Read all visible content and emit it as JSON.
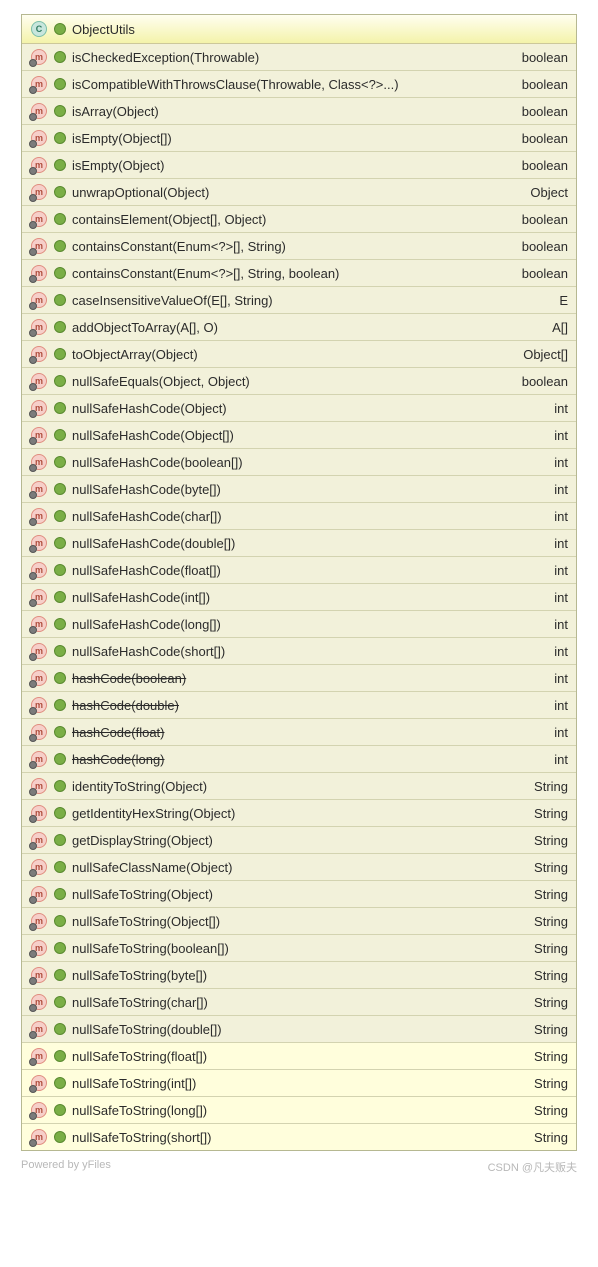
{
  "header": {
    "className": "ObjectUtils"
  },
  "rows": [
    {
      "name": "isCheckedException(Throwable)",
      "ret": "boolean",
      "deprecated": false,
      "highlight": false
    },
    {
      "name": "isCompatibleWithThrowsClause(Throwable, Class<?>...)",
      "ret": "boolean",
      "deprecated": false,
      "highlight": false
    },
    {
      "name": "isArray(Object)",
      "ret": "boolean",
      "deprecated": false,
      "highlight": false
    },
    {
      "name": "isEmpty(Object[])",
      "ret": "boolean",
      "deprecated": false,
      "highlight": false
    },
    {
      "name": "isEmpty(Object)",
      "ret": "boolean",
      "deprecated": false,
      "highlight": false
    },
    {
      "name": "unwrapOptional(Object)",
      "ret": "Object",
      "deprecated": false,
      "highlight": false
    },
    {
      "name": "containsElement(Object[], Object)",
      "ret": "boolean",
      "deprecated": false,
      "highlight": false
    },
    {
      "name": "containsConstant(Enum<?>[], String)",
      "ret": "boolean",
      "deprecated": false,
      "highlight": false
    },
    {
      "name": "containsConstant(Enum<?>[], String, boolean)",
      "ret": "boolean",
      "deprecated": false,
      "highlight": false
    },
    {
      "name": "caseInsensitiveValueOf(E[], String)",
      "ret": "E",
      "deprecated": false,
      "highlight": false
    },
    {
      "name": "addObjectToArray(A[], O)",
      "ret": "A[]",
      "deprecated": false,
      "highlight": false
    },
    {
      "name": "toObjectArray(Object)",
      "ret": "Object[]",
      "deprecated": false,
      "highlight": false
    },
    {
      "name": "nullSafeEquals(Object, Object)",
      "ret": "boolean",
      "deprecated": false,
      "highlight": false
    },
    {
      "name": "nullSafeHashCode(Object)",
      "ret": "int",
      "deprecated": false,
      "highlight": false
    },
    {
      "name": "nullSafeHashCode(Object[])",
      "ret": "int",
      "deprecated": false,
      "highlight": false
    },
    {
      "name": "nullSafeHashCode(boolean[])",
      "ret": "int",
      "deprecated": false,
      "highlight": false
    },
    {
      "name": "nullSafeHashCode(byte[])",
      "ret": "int",
      "deprecated": false,
      "highlight": false
    },
    {
      "name": "nullSafeHashCode(char[])",
      "ret": "int",
      "deprecated": false,
      "highlight": false
    },
    {
      "name": "nullSafeHashCode(double[])",
      "ret": "int",
      "deprecated": false,
      "highlight": false
    },
    {
      "name": "nullSafeHashCode(float[])",
      "ret": "int",
      "deprecated": false,
      "highlight": false
    },
    {
      "name": "nullSafeHashCode(int[])",
      "ret": "int",
      "deprecated": false,
      "highlight": false
    },
    {
      "name": "nullSafeHashCode(long[])",
      "ret": "int",
      "deprecated": false,
      "highlight": false
    },
    {
      "name": "nullSafeHashCode(short[])",
      "ret": "int",
      "deprecated": false,
      "highlight": false
    },
    {
      "name": "hashCode(boolean)",
      "ret": "int",
      "deprecated": true,
      "highlight": false
    },
    {
      "name": "hashCode(double)",
      "ret": "int",
      "deprecated": true,
      "highlight": false
    },
    {
      "name": "hashCode(float)",
      "ret": "int",
      "deprecated": true,
      "highlight": false
    },
    {
      "name": "hashCode(long)",
      "ret": "int",
      "deprecated": true,
      "highlight": false
    },
    {
      "name": "identityToString(Object)",
      "ret": "String",
      "deprecated": false,
      "highlight": false
    },
    {
      "name": "getIdentityHexString(Object)",
      "ret": "String",
      "deprecated": false,
      "highlight": false
    },
    {
      "name": "getDisplayString(Object)",
      "ret": "String",
      "deprecated": false,
      "highlight": false
    },
    {
      "name": "nullSafeClassName(Object)",
      "ret": "String",
      "deprecated": false,
      "highlight": false
    },
    {
      "name": "nullSafeToString(Object)",
      "ret": "String",
      "deprecated": false,
      "highlight": false
    },
    {
      "name": "nullSafeToString(Object[])",
      "ret": "String",
      "deprecated": false,
      "highlight": false
    },
    {
      "name": "nullSafeToString(boolean[])",
      "ret": "String",
      "deprecated": false,
      "highlight": false
    },
    {
      "name": "nullSafeToString(byte[])",
      "ret": "String",
      "deprecated": false,
      "highlight": false
    },
    {
      "name": "nullSafeToString(char[])",
      "ret": "String",
      "deprecated": false,
      "highlight": false
    },
    {
      "name": "nullSafeToString(double[])",
      "ret": "String",
      "deprecated": false,
      "highlight": false
    },
    {
      "name": "nullSafeToString(float[])",
      "ret": "String",
      "deprecated": false,
      "highlight": true
    },
    {
      "name": "nullSafeToString(int[])",
      "ret": "String",
      "deprecated": false,
      "highlight": true
    },
    {
      "name": "nullSafeToString(long[])",
      "ret": "String",
      "deprecated": false,
      "highlight": true
    },
    {
      "name": "nullSafeToString(short[])",
      "ret": "String",
      "deprecated": false,
      "highlight": true
    }
  ],
  "footer": {
    "left": "Powered by yFiles",
    "right": "CSDN @凡夫贩夫"
  }
}
